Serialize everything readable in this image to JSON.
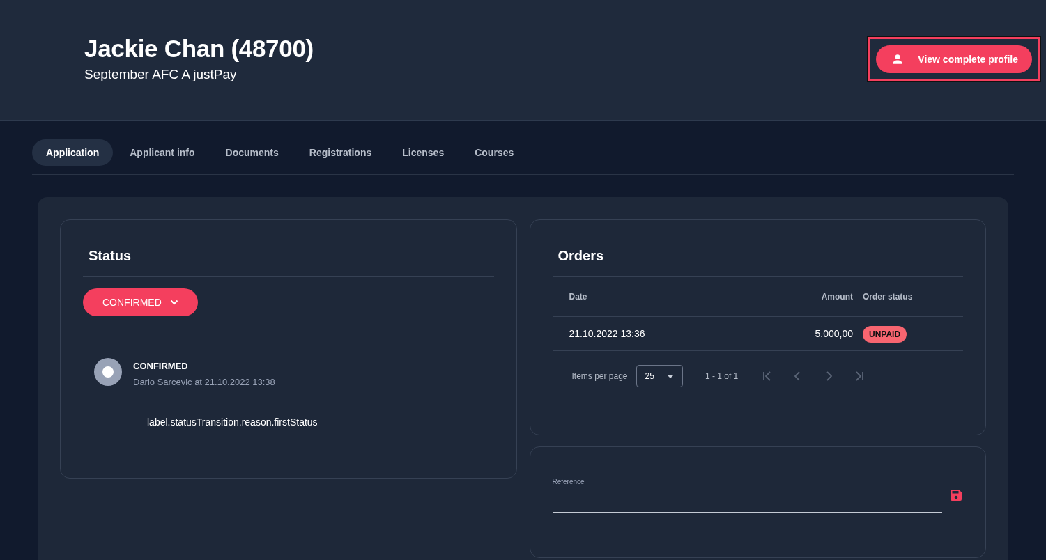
{
  "header": {
    "title": "Jackie Chan (48700)",
    "subtitle": "September AFC A justPay",
    "profile_button": {
      "label": "View complete profile",
      "highlighted": true
    }
  },
  "tabs": [
    {
      "label": "Application",
      "selected": true
    },
    {
      "label": "Applicant info",
      "selected": false
    },
    {
      "label": "Documents",
      "selected": false
    },
    {
      "label": "Registrations",
      "selected": false
    },
    {
      "label": "Licenses",
      "selected": false
    },
    {
      "label": "Courses",
      "selected": false
    }
  ],
  "status": {
    "title": "Status",
    "dropdown": "CONFIRMED",
    "history": [
      {
        "status": "CONFIRMED",
        "meta": "Dario Sarcevic at 21.10.2022 13:38",
        "reason": "label.statusTransition.reason.firstStatus"
      }
    ]
  },
  "orders": {
    "title": "Orders",
    "columns": [
      "Date",
      "Amount",
      "Order status"
    ],
    "rows": [
      {
        "date": "21.10.2022 13:36",
        "amount": "5.000,00",
        "status": "UNPAID"
      }
    ],
    "paginator": {
      "label": "Items per page",
      "page_size": "25",
      "range": "1 - 1 of 1"
    }
  },
  "reference": {
    "label": "Reference"
  }
}
